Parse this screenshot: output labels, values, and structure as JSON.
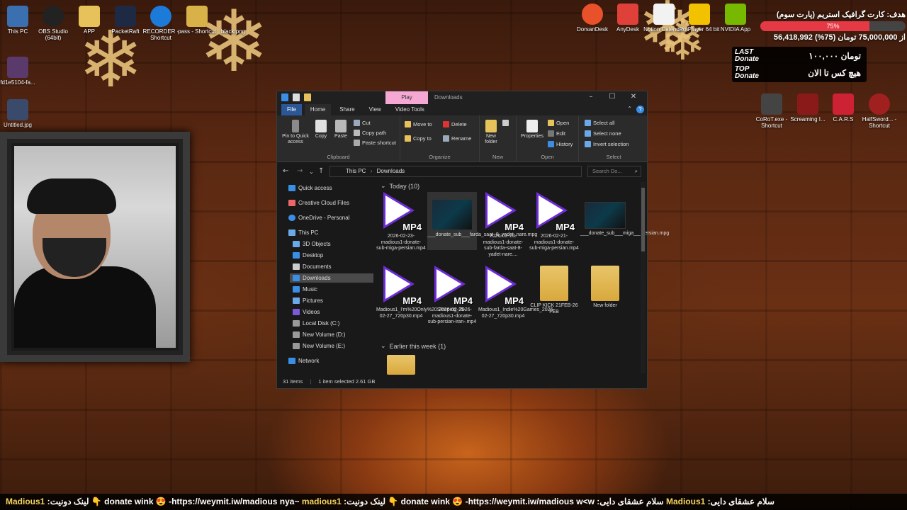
{
  "desktop_icons_left": [
    {
      "label": "This PC"
    },
    {
      "label": "OBS Studio (64bit)"
    },
    {
      "label": "APP"
    },
    {
      "label": "PacketRaft"
    },
    {
      "label": "RECORDER - Shortcut"
    },
    {
      "label": "pass - Shortcut"
    },
    {
      "label": "black.png"
    },
    {
      "label": "fd1e5104-fa..."
    },
    {
      "label": "Untitled.jpg"
    }
  ],
  "desktop_icons_right": [
    {
      "label": "DorsanDesk"
    },
    {
      "label": "AnyDesk"
    },
    {
      "label": "Notion Calendar"
    },
    {
      "label": "PotPlayer 64 bit"
    },
    {
      "label": "NVIDIA App"
    },
    {
      "label": "CoRoT.exe - Shortcut"
    },
    {
      "label": "Screaming I..."
    },
    {
      "label": "C.A.R.S"
    },
    {
      "label": "HalfSword... - Shortcut"
    }
  ],
  "donate_goal": {
    "title": "هدف: کارت گرافیک استریم (پارت سوم)",
    "percent_label": "75%",
    "percent": 0.75,
    "amount": "56,418,992 از 75,000,000 تومان (75%)"
  },
  "donate_panel": {
    "last_label": "LAST Donate",
    "last_value": "۱۰۰,۰۰۰ تومان",
    "top_label": "TOP Donate",
    "top_value": "هیچ کس تا الان"
  },
  "explorer": {
    "play_tab": "Play",
    "title": "Downloads",
    "tabs": [
      "File",
      "Home",
      "Share",
      "View",
      "Video Tools"
    ],
    "clipboard": {
      "pin": "Pin to Quick access",
      "copy": "Copy",
      "paste": "Paste",
      "cut": "Cut",
      "copy_path": "Copy path",
      "paste_shortcut": "Paste shortcut",
      "label": "Clipboard"
    },
    "organize": {
      "move_to": "Move to",
      "copy_to": "Copy to",
      "delete": "Delete",
      "rename": "Rename",
      "label": "Organize"
    },
    "new": {
      "new_folder": "New folder",
      "label": "New"
    },
    "open": {
      "properties": "Properties",
      "open": "Open",
      "edit": "Edit",
      "history": "History",
      "label": "Open"
    },
    "select": {
      "select_all": "Select all",
      "select_none": "Select none",
      "invert": "Invert selection",
      "label": "Select"
    },
    "address": {
      "this_pc": "This PC",
      "downloads": "Downloads"
    },
    "search_placeholder": "Search Do...",
    "nav": [
      "Quick access",
      "Creative Cloud Files",
      "OneDrive - Personal",
      "This PC",
      "3D Objects",
      "Desktop",
      "Documents",
      "Downloads",
      "Music",
      "Pictures",
      "Videos",
      "Local Disk (C:)",
      "New Volume (D:)",
      "New Volume (E:)",
      "Network"
    ],
    "group_today": "Today (10)",
    "group_week": "Earlier this week (1)",
    "files": [
      {
        "name": "2026-02-23-madious1-donate-sub-miga-persian.mp4",
        "type": "mp4"
      },
      {
        "name": "___donate_sub___farda_saat_8_yadet_nare.mpg",
        "type": "video"
      },
      {
        "name": "2026-02-20-madious1-donate-sub-farda-saat-8-yadet-nare....",
        "type": "mp4"
      },
      {
        "name": "2026-02-21-madious1-donate-sub-miga-persian.mp4",
        "type": "mp4"
      },
      {
        "name": "___donate_sub___miga___persian.mpg",
        "type": "video"
      },
      {
        "name": "Madious1_I'm%20Only%20Sleeping_2026-02-27_720p30.mp4",
        "type": "mp4"
      },
      {
        "name": "2026-02-25-madious1-donate-sub-persian-iran-.mp4",
        "type": "mp4"
      },
      {
        "name": "Madious1_Indie%20Games_2026-02-27_720p30.mp4",
        "type": "mp4"
      },
      {
        "name": "CLIP KICK 21FEB-26 FEB",
        "type": "folder"
      },
      {
        "name": "New folder",
        "type": "folder"
      }
    ],
    "mp4_label": "MP4",
    "status": {
      "items": "31 items",
      "selected": "1 item selected  2.61 GB"
    }
  },
  "ticker": {
    "name1": "Madious1",
    "text1": " :لینک دونیت 👇 donate wink 😍 -https://weymit.iw/madious nya~ ",
    "name2": "madious1",
    "text2": " :لینک دونیت 👇 donate wink 😍 -https://weymit.iw/madious w<w :سلام عشقای دایی ",
    "name3": "Madious1",
    "text3": " :سلام عشقای دایی"
  }
}
